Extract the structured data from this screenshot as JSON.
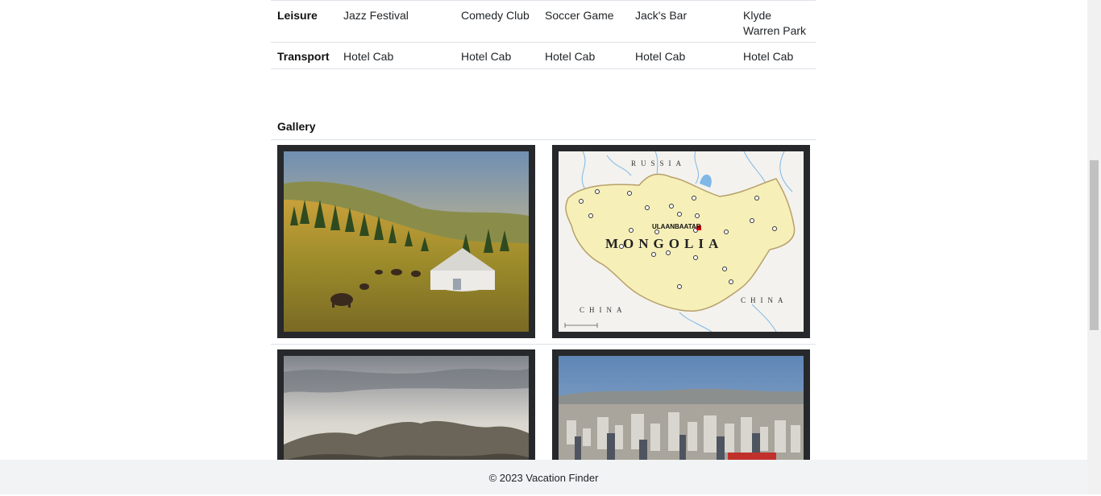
{
  "schedule": {
    "rows": [
      {
        "label": "Leisure",
        "cells": [
          "Jazz Festival",
          "Comedy Club",
          "Soccer Game",
          "Jack's Bar",
          "Klyde Warren Park"
        ]
      },
      {
        "label": "Transport",
        "cells": [
          "Hotel Cab",
          "Hotel Cab",
          "Hotel Cab",
          "Hotel Cab",
          "Hotel Cab"
        ]
      }
    ]
  },
  "gallery": {
    "title": "Gallery",
    "images": [
      {
        "name": "mongolia-steppe-yurt-photo"
      },
      {
        "name": "mongolia-map-image",
        "labels": {
          "country": "MONGOLIA",
          "capital": "ULAANBAATAR",
          "north": "RUSSIA",
          "south_west": "CHINA",
          "south_east": "CHINA"
        }
      },
      {
        "name": "mongolia-mountains-photo"
      },
      {
        "name": "ulaanbaatar-city-photo"
      }
    ]
  },
  "footer": {
    "text": "© 2023 Vacation Finder"
  }
}
